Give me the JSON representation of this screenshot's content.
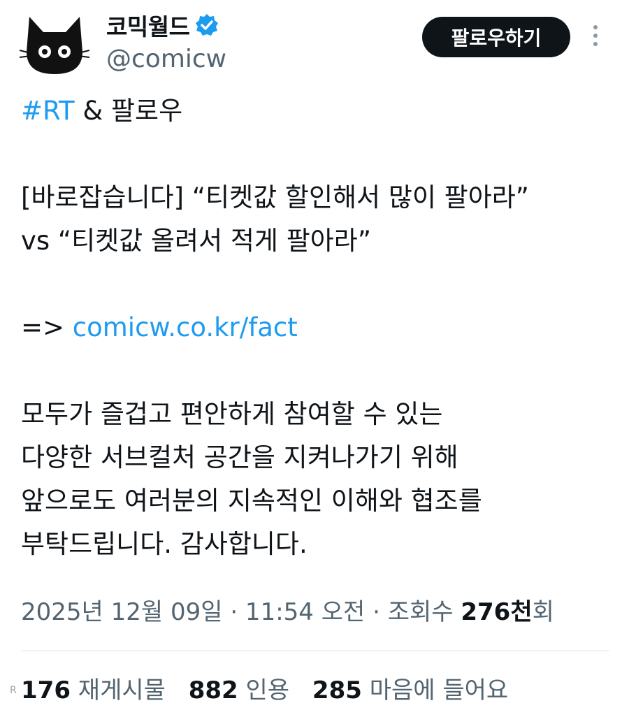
{
  "author": {
    "display_name": "코믹월드",
    "handle": "@comicw",
    "verified": true,
    "avatar_icon": "black-cat-icon"
  },
  "actions": {
    "follow_label": "팔로우하기",
    "more_icon": "more-vertical-icon"
  },
  "tweet": {
    "line1": {
      "hashtag": "#RT",
      "rest": " & 팔로우"
    },
    "line2": "[바로잡습니다] “티켓값 할인해서 많이 팔아라”",
    "line3": "vs “티켓값 올려서 적게 팔아라”",
    "line4": {
      "prefix": "=> ",
      "link": "comicw.co.kr/fact"
    },
    "line5": "모두가 즐겁고 편안하게 참여할 수 있는",
    "line6": "다양한 서브컬처 공간을 지켜나가기 위해",
    "line7": "앞으로도 여러분의 지속적인 이해와 협조를",
    "line8": "부탁드립니다. 감사합니다."
  },
  "meta": {
    "datetime": "2025년 12월 09일 · 11:54 오전 · 조회수 ",
    "views": "276천",
    "views_suffix": "회"
  },
  "stats": {
    "reposts": "176",
    "reposts_label": " 재게시물",
    "quotes": "882",
    "quotes_label": " 인용",
    "likes": "285",
    "likes_label": " 마음에 들어요"
  },
  "corner_mark": "R",
  "colors": {
    "link": "#1d9bf0",
    "verified": "#1d9bf0",
    "button": "#0f1419",
    "muted": "#536471"
  }
}
